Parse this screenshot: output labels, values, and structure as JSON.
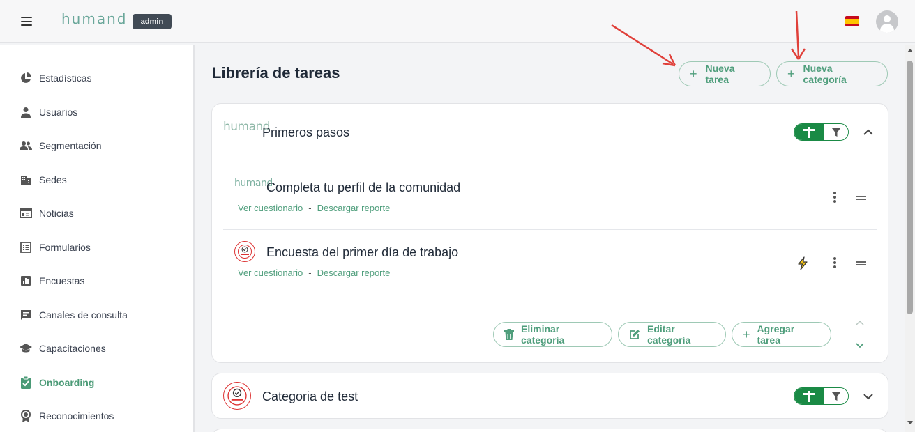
{
  "header": {
    "logo": "humand",
    "badge": "admin",
    "language_flag": "spain-flag",
    "menu_icon": "hamburger-icon",
    "avatar_icon": "user-avatar-icon"
  },
  "sidebar": {
    "items": [
      {
        "label": "Estadísticas",
        "icon": "pie-chart-icon"
      },
      {
        "label": "Usuarios",
        "icon": "person-icon"
      },
      {
        "label": "Segmentación",
        "icon": "people-icon"
      },
      {
        "label": "Sedes",
        "icon": "building-icon"
      },
      {
        "label": "Noticias",
        "icon": "newspaper-icon"
      },
      {
        "label": "Formularios",
        "icon": "list-icon"
      },
      {
        "label": "Encuestas",
        "icon": "bar-chart-icon"
      },
      {
        "label": "Canales de consulta",
        "icon": "chat-icon"
      },
      {
        "label": "Capacitaciones",
        "icon": "graduation-cap-icon"
      },
      {
        "label": "Onboarding",
        "icon": "clipboard-check-icon",
        "active": true
      },
      {
        "label": "Reconocimientos",
        "icon": "award-icon"
      }
    ],
    "active_color": "#4a9a76"
  },
  "main": {
    "title": "Librería de tareas",
    "new_task_label": "Nueva tarea",
    "new_category_label": "Nueva categoría",
    "categories": [
      {
        "title": "Primeros pasos",
        "logo": "humand",
        "expanded": true,
        "tasks": [
          {
            "title": "Completa tu perfil de la comunidad",
            "logo": "humand",
            "link_view": "Ver cuestionario",
            "link_sep": "-",
            "link_report": "Descargar reporte"
          },
          {
            "title": "Encuesta del primer día de trabajo",
            "logo": "CALIDAD",
            "link_view": "Ver cuestionario",
            "link_sep": "-",
            "link_report": "Descargar reporte",
            "has_lightning": true
          }
        ],
        "actions": {
          "delete": "Eliminar categoría",
          "edit": "Editar categoría",
          "add": "Agregar tarea"
        }
      },
      {
        "title": "Categoria de test",
        "logo": "CALIDAD",
        "expanded": false
      }
    ]
  },
  "colors": {
    "accent": "#4f9e7c",
    "toggle_green": "#1a8a45",
    "annotation_arrow": "#e0403a"
  }
}
